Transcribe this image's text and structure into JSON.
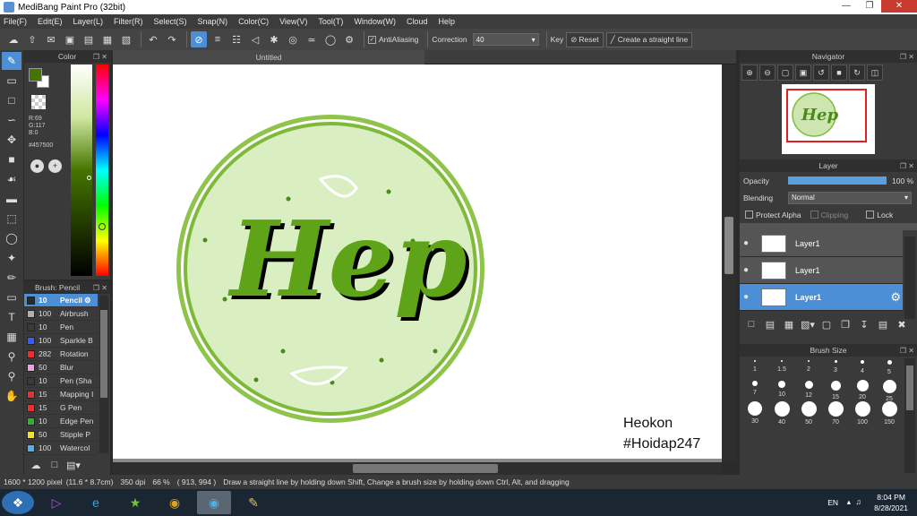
{
  "window": {
    "title": "MediBang Paint Pro (32bit)"
  },
  "menu": [
    "File(F)",
    "Edit(E)",
    "Layer(L)",
    "Filter(R)",
    "Select(S)",
    "Snap(N)",
    "Color(C)",
    "View(V)",
    "Tool(T)",
    "Window(W)",
    "Cloud",
    "Help"
  ],
  "toolbar": {
    "antialiasing_label": "AntiAliasing",
    "correction_label": "Correction",
    "correction_value": "40",
    "key_label": "Key",
    "reset_label": "Reset",
    "straight_line_label": "Create a straight line"
  },
  "color_panel": {
    "title": "Color",
    "rgb": {
      "r": "R:69",
      "g": "G:117",
      "b": "B:0"
    },
    "hex": "#457500",
    "fg_color": "#457500",
    "bg_color": "#ffffff"
  },
  "brush_panel": {
    "title": "Brush: Pencil",
    "items": [
      {
        "size": "10",
        "name": "Pencil",
        "color": "#2a2a2a"
      },
      {
        "size": "100",
        "name": "Airbrush",
        "color": "#b0b0b0"
      },
      {
        "size": "10",
        "name": "Pen",
        "color": "#3a3a3a"
      },
      {
        "size": "100",
        "name": "Sparkle B",
        "color": "#3a5aff"
      },
      {
        "size": "282",
        "name": "Rotation",
        "color": "#e83030"
      },
      {
        "size": "50",
        "name": "Blur",
        "color": "#f0a0e0"
      },
      {
        "size": "10",
        "name": "Pen (Sha",
        "color": "#3a3a3a"
      },
      {
        "size": "15",
        "name": "Mapping I",
        "color": "#e83030"
      },
      {
        "size": "15",
        "name": "G Pen",
        "color": "#e83030"
      },
      {
        "size": "10",
        "name": "Edge Pen",
        "color": "#30b030"
      },
      {
        "size": "50",
        "name": "Stipple P",
        "color": "#f0e030"
      },
      {
        "size": "100",
        "name": "Watercol",
        "color": "#50b0f0"
      }
    ]
  },
  "document": {
    "tab_title": "Untitled",
    "artwork_text": "Hep",
    "signature_line1": "Heokon",
    "signature_line2": "#Hoidap247"
  },
  "navigator": {
    "title": "Navigator"
  },
  "layer_panel": {
    "title": "Layer",
    "opacity_label": "Opacity",
    "opacity_value": "100 %",
    "opacity_fraction": 1.0,
    "blending_label": "Blending",
    "blending_value": "Normal",
    "protect_alpha_label": "Protect Alpha",
    "clipping_label": "Clipping",
    "lock_label": "Lock",
    "layers": [
      {
        "name": "Layer1"
      },
      {
        "name": "Layer1"
      },
      {
        "name": "Layer1"
      }
    ]
  },
  "brush_size_panel": {
    "title": "Brush Size",
    "sizes": [
      "1",
      "1.5",
      "2",
      "3",
      "4",
      "5",
      "7",
      "10",
      "12",
      "15",
      "20",
      "25",
      "30",
      "40",
      "50",
      "70",
      "100",
      "150"
    ]
  },
  "status": {
    "pixels": "1600 * 1200 pixel",
    "cm": "(11.6 * 8.7cm)",
    "dpi": "350 dpi",
    "zoom": "66 %",
    "cursor": "( 913, 994 )",
    "hint": "Draw a straight line by holding down Shift, Change a brush size by holding down Ctrl, Alt, and dragging"
  },
  "taskbar": {
    "lang": "EN",
    "time": "8:04 PM",
    "date": "8/28/2021"
  }
}
